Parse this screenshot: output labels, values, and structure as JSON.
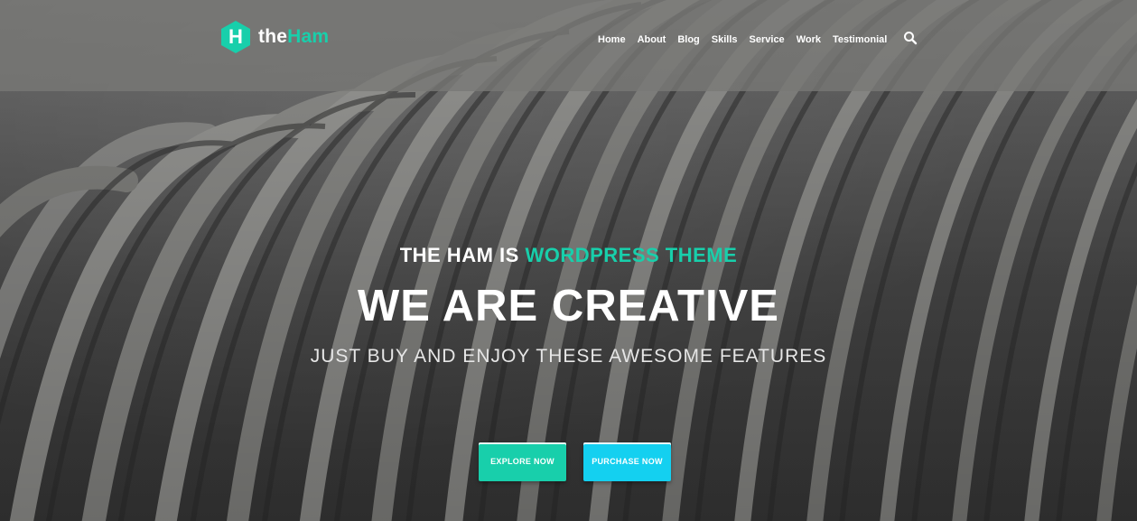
{
  "brand": {
    "logo_letter": "H",
    "name_prefix": "the",
    "name_suffix": "Ham",
    "accent_color": "#18cfab"
  },
  "nav": {
    "items": [
      {
        "label": "Home"
      },
      {
        "label": "About"
      },
      {
        "label": "Blog"
      },
      {
        "label": "Skills"
      },
      {
        "label": "Service"
      },
      {
        "label": "Work"
      },
      {
        "label": "Testimonial"
      }
    ],
    "search_icon": "search-icon"
  },
  "hero": {
    "tagline_prefix": "THE HAM IS",
    "tagline_highlight": "WORDPRESS THEME",
    "headline": "WE ARE CREATIVE",
    "subline": "JUST BUY AND ENJOY THESE AWESOME FEATURES",
    "background": "grayscale architectural curved stripes"
  },
  "buttons": {
    "explore_label": "EXPLORE NOW",
    "explore_color": "#18cfab",
    "purchase_label": "PURCHASE NOW",
    "purchase_color": "#14d0f0"
  }
}
